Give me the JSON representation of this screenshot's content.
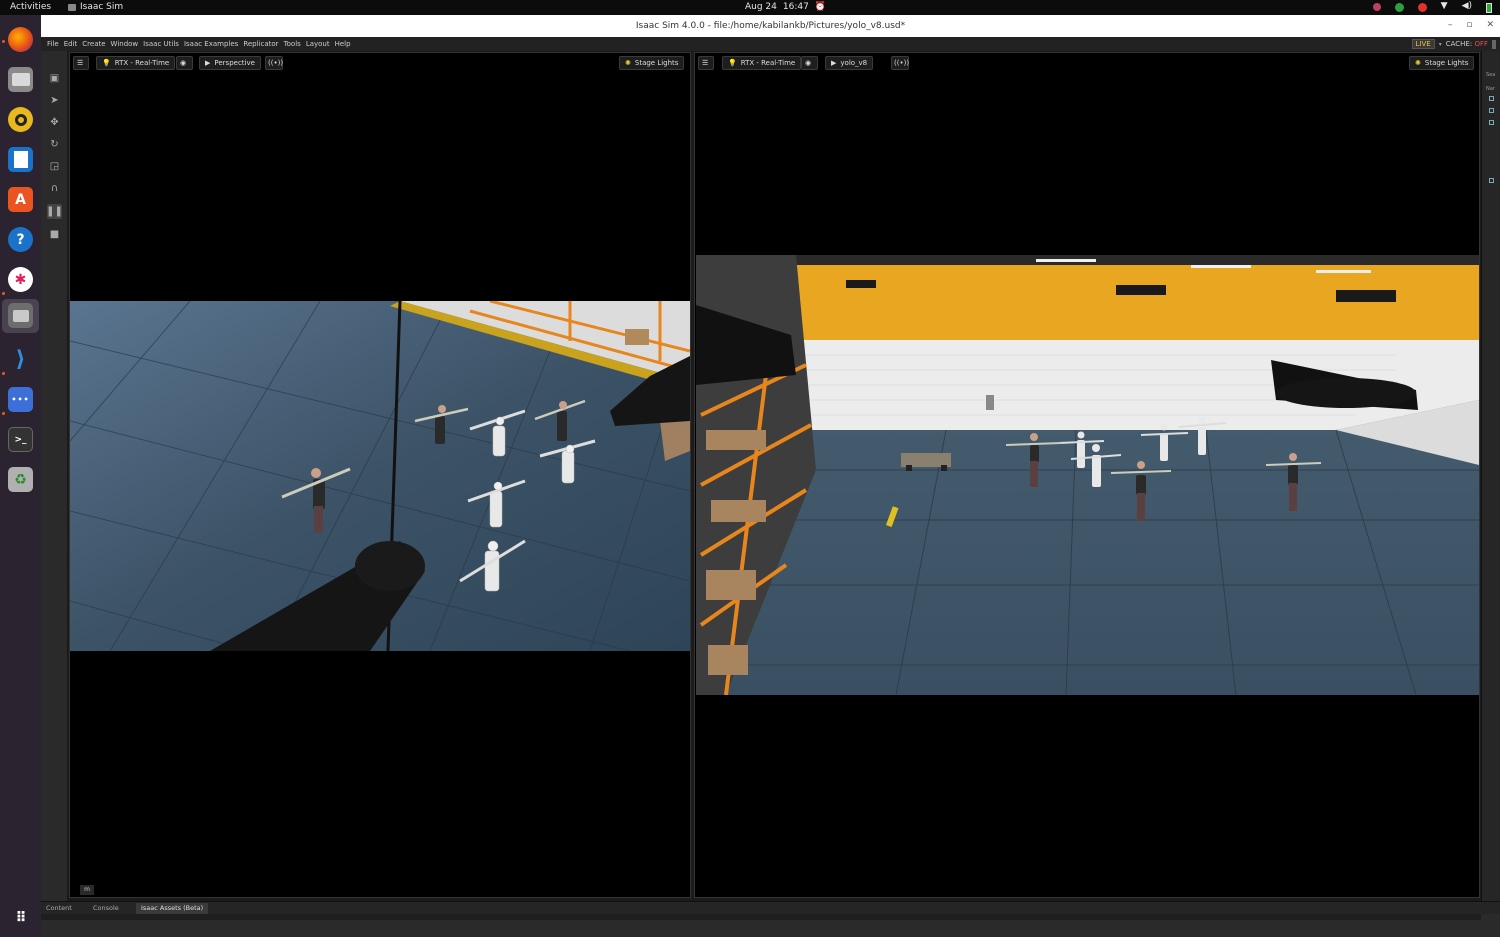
{
  "topbar": {
    "activities": "Activities",
    "app_name": "Isaac Sim",
    "date": "Aug 24",
    "time": "16:47"
  },
  "window": {
    "title": "Isaac Sim 4.0.0 - file:/home/kabilankb/Pictures/yolo_v8.usd*"
  },
  "menu": {
    "items": [
      "File",
      "Edit",
      "Create",
      "Window",
      "Isaac Utils",
      "Isaac Examples",
      "Replicator",
      "Tools",
      "Layout",
      "Help"
    ],
    "live_label": "LIVE",
    "cache_label": "CACHE:",
    "cache_state": "OFF"
  },
  "viewport_left": {
    "render_mode": "RTX - Real-Time",
    "camera": "Perspective",
    "lights": "Stage Lights",
    "m_label": "m"
  },
  "viewport_right": {
    "render_mode": "RTX - Real-Time",
    "camera": "yolo_v8",
    "lights": "Stage Lights"
  },
  "right_panel": {
    "search_abbrev": "Sea",
    "name_abbrev": "Nar"
  },
  "bottom_tabs": [
    "Content",
    "Console",
    "Isaac Assets (Beta)"
  ],
  "colors": {
    "accent": "#e95420",
    "floor": "#3c5266",
    "wall_yellow": "#e8a621",
    "shelf_orange": "#e8861e"
  }
}
